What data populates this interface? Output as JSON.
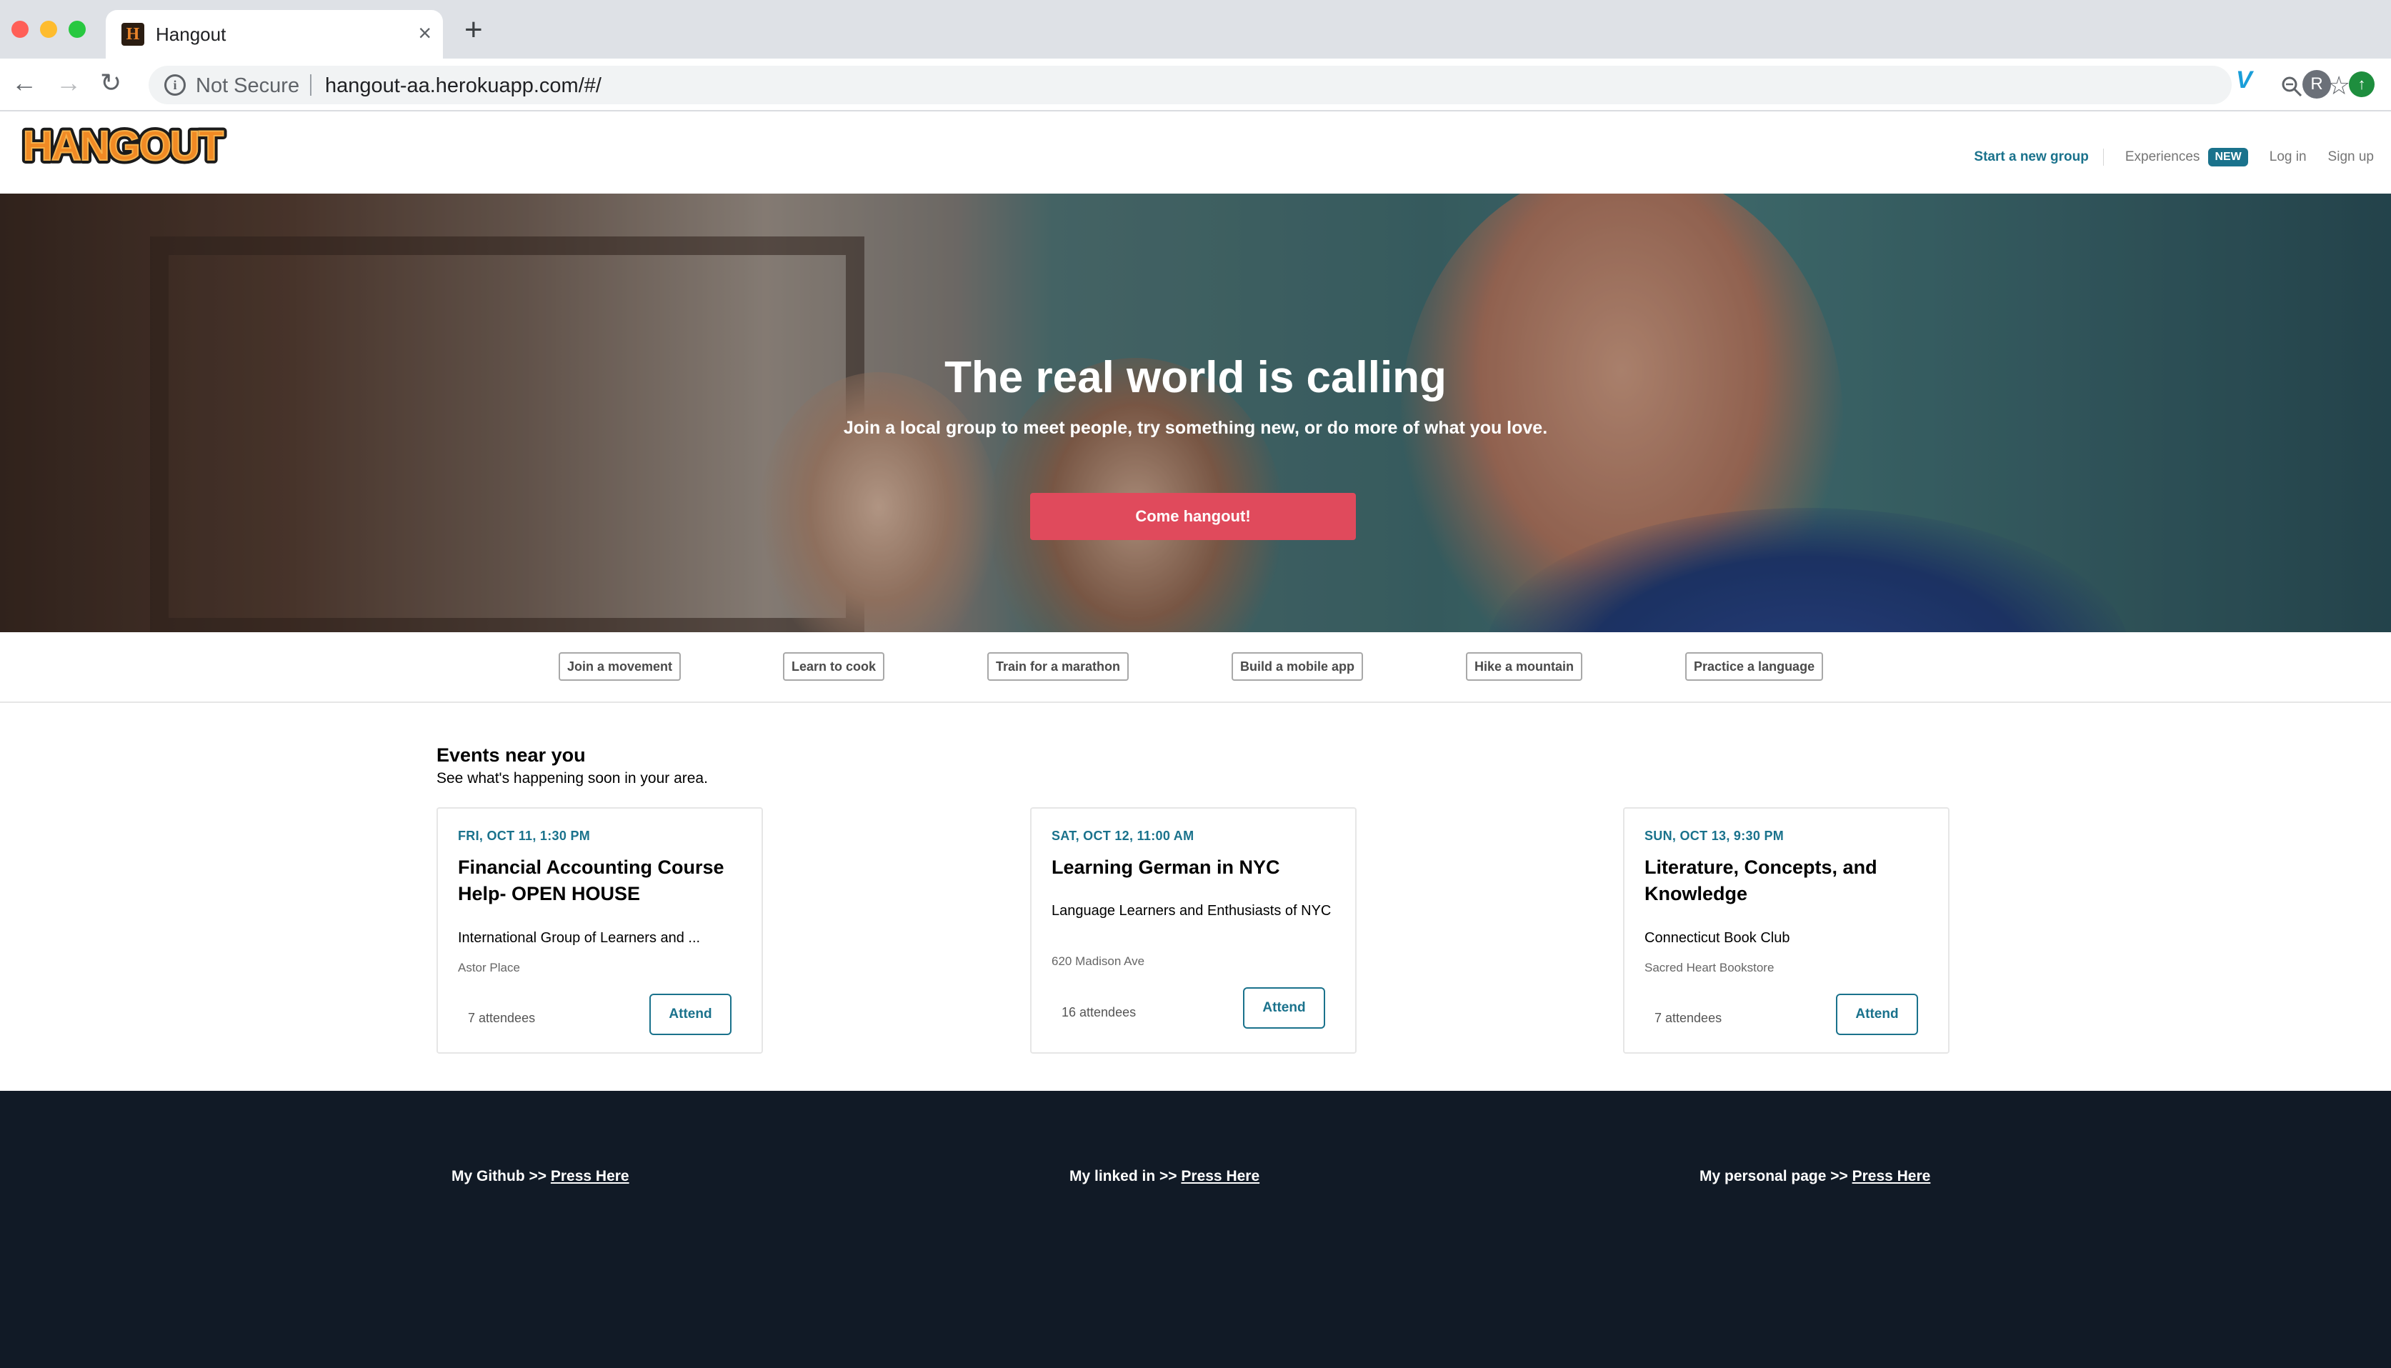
{
  "browser": {
    "tab_title": "Hangout",
    "tab_favicon_letter": "H",
    "security_label": "Not Secure",
    "url": "hangout-aa.herokuapp.com/#/",
    "profile_initial": "R"
  },
  "header": {
    "logo_text": "HANGOUT",
    "links": {
      "start_group": "Start a new group",
      "experiences": "Experiences",
      "new_badge": "NEW",
      "login": "Log in",
      "signup": "Sign up"
    }
  },
  "hero": {
    "title": "The real world is calling",
    "subtitle": "Join a local group to meet people, try something new, or do more of what you love.",
    "cta": "Come hangout!"
  },
  "topics": [
    "Join a movement",
    "Learn to cook",
    "Train for a marathon",
    "Build a mobile app",
    "Hike a mountain",
    "Practice a language"
  ],
  "events": {
    "title": "Events near you",
    "subtitle": "See what's happening soon in your area.",
    "cards": [
      {
        "date": "FRI, OCT 11, 1:30 PM",
        "title": "Financial Accounting Course Help- OPEN HOUSE",
        "group": "International Group of Learners and ...",
        "venue": "Astor Place",
        "attendees": "7 attendees",
        "button": "Attend"
      },
      {
        "date": "SAT, OCT 12, 11:00 AM",
        "title": "Learning German in NYC",
        "group": "Language Learners and Enthusiasts of NYC",
        "venue": "620 Madison Ave",
        "attendees": "16 attendees",
        "button": "Attend"
      },
      {
        "date": "SUN, OCT 13, 9:30 PM",
        "title": "Literature, Concepts, and Knowledge",
        "group": "Connecticut Book Club",
        "venue": "Sacred Heart Bookstore",
        "attendees": "7 attendees",
        "button": "Attend"
      }
    ]
  },
  "footer": {
    "github_label": "My Github >> ",
    "linkedin_label": "My linked in >> ",
    "personal_label": "My personal page >> ",
    "link_text": "Press Here"
  },
  "colors": {
    "accent": "#1a728c",
    "cta": "#e04a5c",
    "footer_bg": "#111a26"
  }
}
